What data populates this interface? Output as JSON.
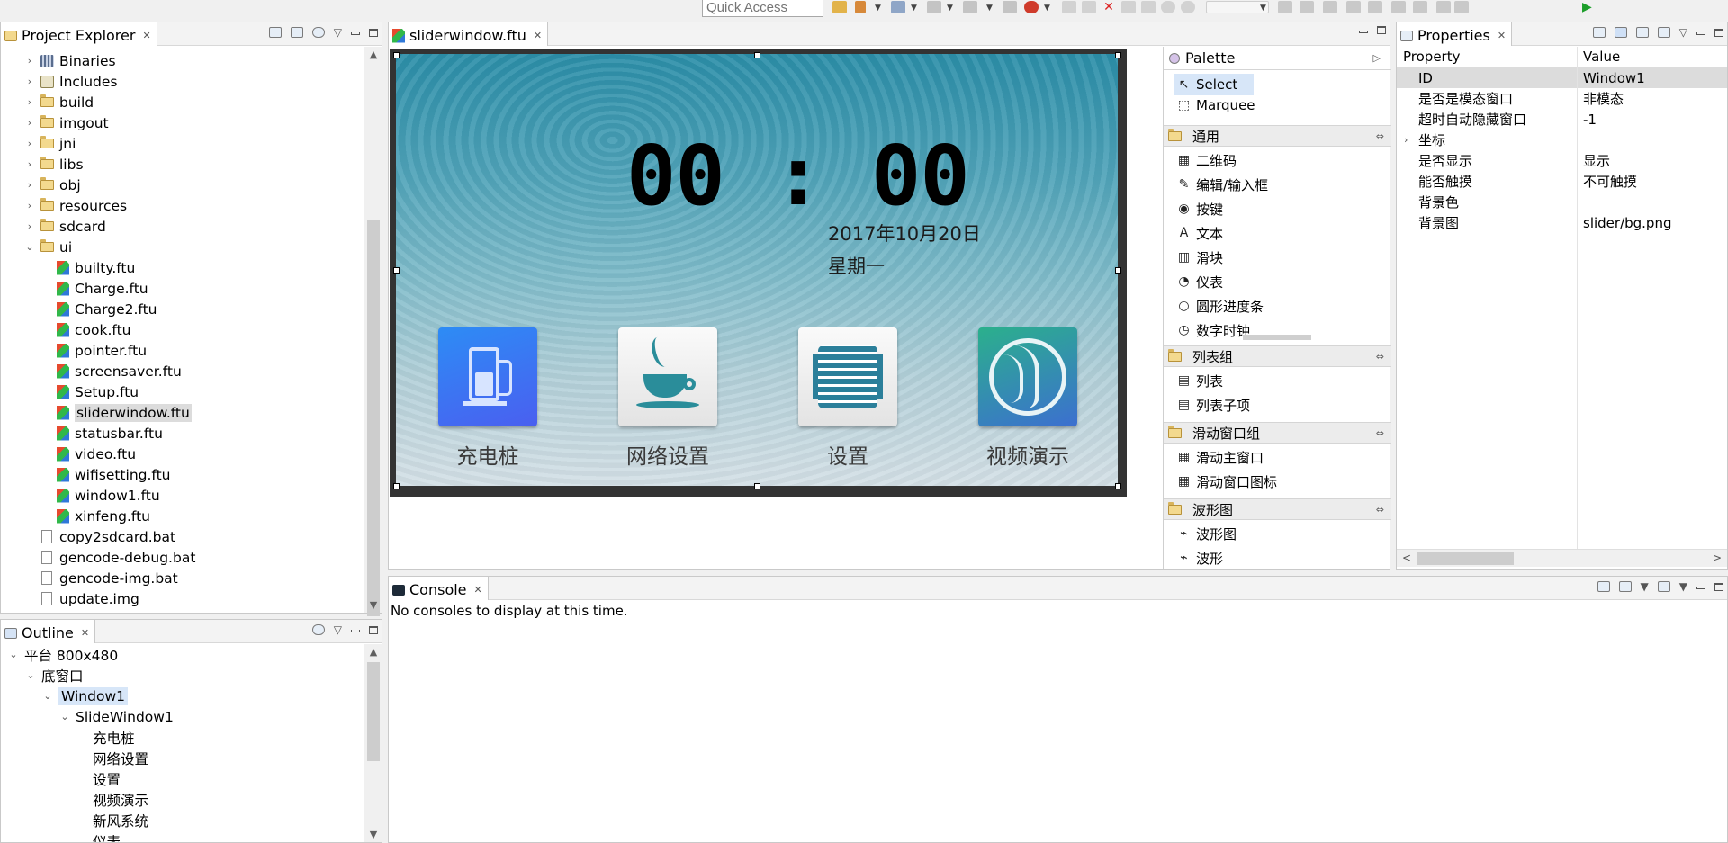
{
  "toolbar": {
    "quick_access_placeholder": "Quick Access"
  },
  "project_explorer": {
    "title": "Project Explorer",
    "items": [
      {
        "label": "Binaries",
        "type": "binaries",
        "expandable": true
      },
      {
        "label": "Includes",
        "type": "includes",
        "expandable": true
      },
      {
        "label": "build",
        "type": "folder",
        "expandable": true
      },
      {
        "label": "imgout",
        "type": "folder",
        "expandable": true
      },
      {
        "label": "jni",
        "type": "folder",
        "expandable": true
      },
      {
        "label": "libs",
        "type": "folder",
        "expandable": true
      },
      {
        "label": "obj",
        "type": "folder",
        "expandable": true
      },
      {
        "label": "resources",
        "type": "folder",
        "expandable": true
      },
      {
        "label": "sdcard",
        "type": "folder",
        "expandable": true
      },
      {
        "label": "ui",
        "type": "folder",
        "expandable": true,
        "expanded": true
      },
      {
        "label": "builty.ftu",
        "type": "ftu"
      },
      {
        "label": "Charge.ftu",
        "type": "ftu"
      },
      {
        "label": "Charge2.ftu",
        "type": "ftu"
      },
      {
        "label": "cook.ftu",
        "type": "ftu"
      },
      {
        "label": "pointer.ftu",
        "type": "ftu"
      },
      {
        "label": "screensaver.ftu",
        "type": "ftu"
      },
      {
        "label": "Setup.ftu",
        "type": "ftu"
      },
      {
        "label": "sliderwindow.ftu",
        "type": "ftu",
        "selected": true
      },
      {
        "label": "statusbar.ftu",
        "type": "ftu"
      },
      {
        "label": "video.ftu",
        "type": "ftu"
      },
      {
        "label": "wifisetting.ftu",
        "type": "ftu"
      },
      {
        "label": "window1.ftu",
        "type": "ftu"
      },
      {
        "label": "xinfeng.ftu",
        "type": "ftu"
      },
      {
        "label": "copy2sdcard.bat",
        "type": "file"
      },
      {
        "label": "gencode-debug.bat",
        "type": "file"
      },
      {
        "label": "gencode-img.bat",
        "type": "file"
      },
      {
        "label": "update.img",
        "type": "file"
      }
    ]
  },
  "outline": {
    "title": "Outline",
    "items": [
      {
        "label": "平台 800x480"
      },
      {
        "label": "底窗口"
      },
      {
        "label": "Window1",
        "selected": true
      },
      {
        "label": "SlideWindow1"
      },
      {
        "label": "充电桩"
      },
      {
        "label": "网络设置"
      },
      {
        "label": "设置"
      },
      {
        "label": "视频演示"
      },
      {
        "label": "新风系统"
      },
      {
        "label": "仪表"
      }
    ]
  },
  "editor": {
    "tab_title": "sliderwindow.ftu",
    "screen": {
      "clock": "00 : 00",
      "date": "2017年10月20日",
      "weekday": "星期一",
      "apps": [
        {
          "label": "充电桩",
          "icon": "fuel-station-icon"
        },
        {
          "label": "网络设置",
          "icon": "coffee-cup-icon"
        },
        {
          "label": "设置",
          "icon": "grid-settings-icon"
        },
        {
          "label": "视频演示",
          "icon": "face-profile-icon"
        }
      ]
    }
  },
  "palette": {
    "title": "Palette",
    "tools": [
      {
        "label": "Select",
        "selected": true
      },
      {
        "label": "Marquee"
      }
    ],
    "groups": [
      {
        "label": "通用",
        "items": [
          "二维码",
          "编辑/输入框",
          "按键",
          "文本",
          "滑块",
          "仪表",
          "圆形进度条",
          "数字时钟"
        ]
      },
      {
        "label": "列表组",
        "items": [
          "列表",
          "列表子项"
        ]
      },
      {
        "label": "滑动窗口组",
        "items": [
          "滑动主窗口",
          "滑动窗口图标"
        ]
      },
      {
        "label": "波形图",
        "items": [
          "波形图",
          "波形"
        ]
      }
    ]
  },
  "properties": {
    "title": "Properties",
    "header": {
      "property": "Property",
      "value": "Value"
    },
    "rows": [
      {
        "k": "ID",
        "v": "Window1",
        "selected": true
      },
      {
        "k": "是否是模态窗口",
        "v": "非模态"
      },
      {
        "k": "超时自动隐藏窗口",
        "v": "-1"
      },
      {
        "k": "坐标",
        "v": "",
        "expandable": true
      },
      {
        "k": "是否显示",
        "v": "显示"
      },
      {
        "k": "能否触摸",
        "v": "不可触摸"
      },
      {
        "k": "背景色",
        "v": ""
      },
      {
        "k": "背景图",
        "v": "slider/bg.png"
      }
    ]
  },
  "console": {
    "title": "Console",
    "message": "No consoles to display at this time."
  },
  "colors": {
    "selection": "#dcdcdc",
    "palette_selection": "#d7e6f8",
    "screen_top": "#2b8ea8",
    "screen_bottom": "#d4e0e6"
  }
}
